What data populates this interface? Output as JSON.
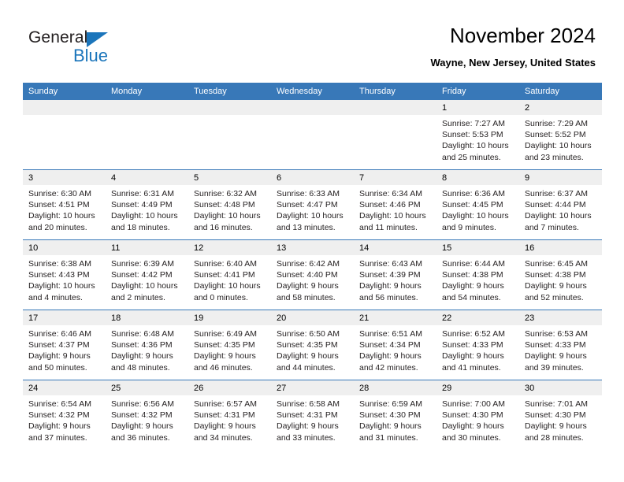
{
  "brand": {
    "name_part1": "General",
    "name_part2": "Blue",
    "triangle_color": "#1b75bb",
    "text_color": "#231f20"
  },
  "header": {
    "title": "November 2024",
    "subtitle": "Wayne, New Jersey, United States"
  },
  "colors": {
    "header_bar": "#3878b8",
    "daynum_band": "#efefef",
    "row_divider": "#3878b8",
    "text": "#231f20"
  },
  "weekday_headers": [
    "Sunday",
    "Monday",
    "Tuesday",
    "Wednesday",
    "Thursday",
    "Friday",
    "Saturday"
  ],
  "weeks": [
    [
      {
        "day": "",
        "sunrise": "",
        "sunset": "",
        "daylight_1": "",
        "daylight_2": ""
      },
      {
        "day": "",
        "sunrise": "",
        "sunset": "",
        "daylight_1": "",
        "daylight_2": ""
      },
      {
        "day": "",
        "sunrise": "",
        "sunset": "",
        "daylight_1": "",
        "daylight_2": ""
      },
      {
        "day": "",
        "sunrise": "",
        "sunset": "",
        "daylight_1": "",
        "daylight_2": ""
      },
      {
        "day": "",
        "sunrise": "",
        "sunset": "",
        "daylight_1": "",
        "daylight_2": ""
      },
      {
        "day": "1",
        "sunrise": "Sunrise: 7:27 AM",
        "sunset": "Sunset: 5:53 PM",
        "daylight_1": "Daylight: 10 hours",
        "daylight_2": "and 25 minutes."
      },
      {
        "day": "2",
        "sunrise": "Sunrise: 7:29 AM",
        "sunset": "Sunset: 5:52 PM",
        "daylight_1": "Daylight: 10 hours",
        "daylight_2": "and 23 minutes."
      }
    ],
    [
      {
        "day": "3",
        "sunrise": "Sunrise: 6:30 AM",
        "sunset": "Sunset: 4:51 PM",
        "daylight_1": "Daylight: 10 hours",
        "daylight_2": "and 20 minutes."
      },
      {
        "day": "4",
        "sunrise": "Sunrise: 6:31 AM",
        "sunset": "Sunset: 4:49 PM",
        "daylight_1": "Daylight: 10 hours",
        "daylight_2": "and 18 minutes."
      },
      {
        "day": "5",
        "sunrise": "Sunrise: 6:32 AM",
        "sunset": "Sunset: 4:48 PM",
        "daylight_1": "Daylight: 10 hours",
        "daylight_2": "and 16 minutes."
      },
      {
        "day": "6",
        "sunrise": "Sunrise: 6:33 AM",
        "sunset": "Sunset: 4:47 PM",
        "daylight_1": "Daylight: 10 hours",
        "daylight_2": "and 13 minutes."
      },
      {
        "day": "7",
        "sunrise": "Sunrise: 6:34 AM",
        "sunset": "Sunset: 4:46 PM",
        "daylight_1": "Daylight: 10 hours",
        "daylight_2": "and 11 minutes."
      },
      {
        "day": "8",
        "sunrise": "Sunrise: 6:36 AM",
        "sunset": "Sunset: 4:45 PM",
        "daylight_1": "Daylight: 10 hours",
        "daylight_2": "and 9 minutes."
      },
      {
        "day": "9",
        "sunrise": "Sunrise: 6:37 AM",
        "sunset": "Sunset: 4:44 PM",
        "daylight_1": "Daylight: 10 hours",
        "daylight_2": "and 7 minutes."
      }
    ],
    [
      {
        "day": "10",
        "sunrise": "Sunrise: 6:38 AM",
        "sunset": "Sunset: 4:43 PM",
        "daylight_1": "Daylight: 10 hours",
        "daylight_2": "and 4 minutes."
      },
      {
        "day": "11",
        "sunrise": "Sunrise: 6:39 AM",
        "sunset": "Sunset: 4:42 PM",
        "daylight_1": "Daylight: 10 hours",
        "daylight_2": "and 2 minutes."
      },
      {
        "day": "12",
        "sunrise": "Sunrise: 6:40 AM",
        "sunset": "Sunset: 4:41 PM",
        "daylight_1": "Daylight: 10 hours",
        "daylight_2": "and 0 minutes."
      },
      {
        "day": "13",
        "sunrise": "Sunrise: 6:42 AM",
        "sunset": "Sunset: 4:40 PM",
        "daylight_1": "Daylight: 9 hours",
        "daylight_2": "and 58 minutes."
      },
      {
        "day": "14",
        "sunrise": "Sunrise: 6:43 AM",
        "sunset": "Sunset: 4:39 PM",
        "daylight_1": "Daylight: 9 hours",
        "daylight_2": "and 56 minutes."
      },
      {
        "day": "15",
        "sunrise": "Sunrise: 6:44 AM",
        "sunset": "Sunset: 4:38 PM",
        "daylight_1": "Daylight: 9 hours",
        "daylight_2": "and 54 minutes."
      },
      {
        "day": "16",
        "sunrise": "Sunrise: 6:45 AM",
        "sunset": "Sunset: 4:38 PM",
        "daylight_1": "Daylight: 9 hours",
        "daylight_2": "and 52 minutes."
      }
    ],
    [
      {
        "day": "17",
        "sunrise": "Sunrise: 6:46 AM",
        "sunset": "Sunset: 4:37 PM",
        "daylight_1": "Daylight: 9 hours",
        "daylight_2": "and 50 minutes."
      },
      {
        "day": "18",
        "sunrise": "Sunrise: 6:48 AM",
        "sunset": "Sunset: 4:36 PM",
        "daylight_1": "Daylight: 9 hours",
        "daylight_2": "and 48 minutes."
      },
      {
        "day": "19",
        "sunrise": "Sunrise: 6:49 AM",
        "sunset": "Sunset: 4:35 PM",
        "daylight_1": "Daylight: 9 hours",
        "daylight_2": "and 46 minutes."
      },
      {
        "day": "20",
        "sunrise": "Sunrise: 6:50 AM",
        "sunset": "Sunset: 4:35 PM",
        "daylight_1": "Daylight: 9 hours",
        "daylight_2": "and 44 minutes."
      },
      {
        "day": "21",
        "sunrise": "Sunrise: 6:51 AM",
        "sunset": "Sunset: 4:34 PM",
        "daylight_1": "Daylight: 9 hours",
        "daylight_2": "and 42 minutes."
      },
      {
        "day": "22",
        "sunrise": "Sunrise: 6:52 AM",
        "sunset": "Sunset: 4:33 PM",
        "daylight_1": "Daylight: 9 hours",
        "daylight_2": "and 41 minutes."
      },
      {
        "day": "23",
        "sunrise": "Sunrise: 6:53 AM",
        "sunset": "Sunset: 4:33 PM",
        "daylight_1": "Daylight: 9 hours",
        "daylight_2": "and 39 minutes."
      }
    ],
    [
      {
        "day": "24",
        "sunrise": "Sunrise: 6:54 AM",
        "sunset": "Sunset: 4:32 PM",
        "daylight_1": "Daylight: 9 hours",
        "daylight_2": "and 37 minutes."
      },
      {
        "day": "25",
        "sunrise": "Sunrise: 6:56 AM",
        "sunset": "Sunset: 4:32 PM",
        "daylight_1": "Daylight: 9 hours",
        "daylight_2": "and 36 minutes."
      },
      {
        "day": "26",
        "sunrise": "Sunrise: 6:57 AM",
        "sunset": "Sunset: 4:31 PM",
        "daylight_1": "Daylight: 9 hours",
        "daylight_2": "and 34 minutes."
      },
      {
        "day": "27",
        "sunrise": "Sunrise: 6:58 AM",
        "sunset": "Sunset: 4:31 PM",
        "daylight_1": "Daylight: 9 hours",
        "daylight_2": "and 33 minutes."
      },
      {
        "day": "28",
        "sunrise": "Sunrise: 6:59 AM",
        "sunset": "Sunset: 4:30 PM",
        "daylight_1": "Daylight: 9 hours",
        "daylight_2": "and 31 minutes."
      },
      {
        "day": "29",
        "sunrise": "Sunrise: 7:00 AM",
        "sunset": "Sunset: 4:30 PM",
        "daylight_1": "Daylight: 9 hours",
        "daylight_2": "and 30 minutes."
      },
      {
        "day": "30",
        "sunrise": "Sunrise: 7:01 AM",
        "sunset": "Sunset: 4:30 PM",
        "daylight_1": "Daylight: 9 hours",
        "daylight_2": "and 28 minutes."
      }
    ]
  ]
}
